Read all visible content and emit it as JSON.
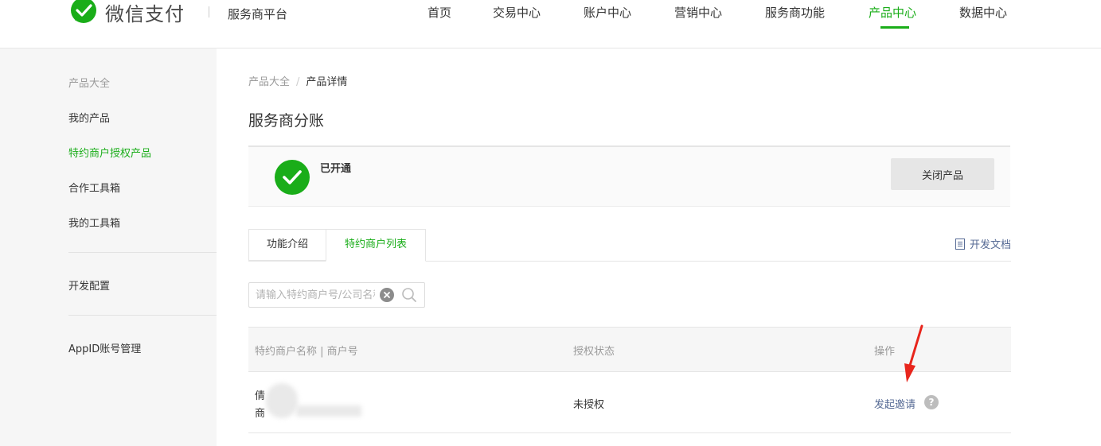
{
  "brand": {
    "logo_text": "微信支付",
    "platform": "服务商平台",
    "accent": "#1aad19"
  },
  "nav": [
    {
      "label": "首页"
    },
    {
      "label": "交易中心"
    },
    {
      "label": "账户中心"
    },
    {
      "label": "营销中心"
    },
    {
      "label": "服务商功能"
    },
    {
      "label": "产品中心",
      "active": true
    },
    {
      "label": "数据中心"
    }
  ],
  "sidebar": {
    "items": [
      {
        "label": "产品大全"
      },
      {
        "label": "我的产品"
      },
      {
        "label": "特约商户授权产品",
        "active": true
      },
      {
        "label": "合作工具箱"
      },
      {
        "label": "我的工具箱"
      },
      {
        "label": "开发配置"
      },
      {
        "label": "AppID账号管理"
      }
    ]
  },
  "breadcrumb": {
    "parent": "产品大全",
    "sep": "/",
    "current": "产品详情"
  },
  "page_title": "服务商分账",
  "status": {
    "text": "已开通",
    "close_button": "关闭产品"
  },
  "tabs": [
    {
      "label": "功能介绍"
    },
    {
      "label": "特约商户列表",
      "active": true
    }
  ],
  "doc_link": "开发文档",
  "search": {
    "placeholder": "请输入特约商户号/公司名称",
    "value": ""
  },
  "table": {
    "headers": {
      "name": "特约商户名称 | 商户号",
      "status": "授权状态",
      "action": "操作"
    },
    "rows": [
      {
        "name_line1": "倩",
        "name_line2": "商",
        "status": "未授权",
        "action": "发起邀请",
        "help": "?"
      }
    ]
  }
}
